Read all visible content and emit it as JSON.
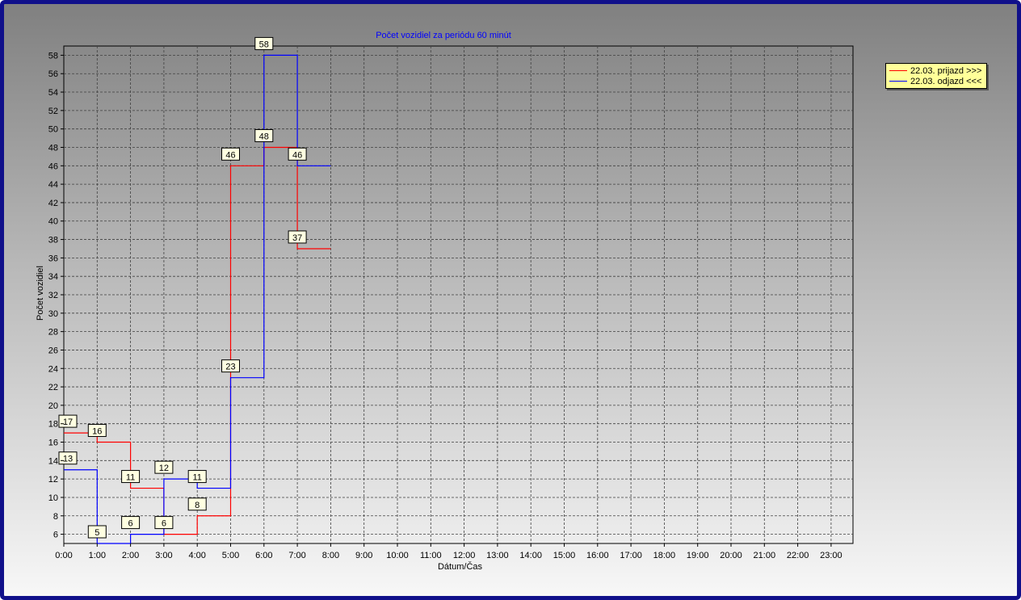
{
  "chart_data": {
    "type": "line",
    "title": "Počet vozidiel za periódu 60 minút",
    "xlabel": "Dátum/Čas",
    "ylabel": "Počet vozidiel",
    "categories": [
      "0:00",
      "1:00",
      "2:00",
      "3:00",
      "4:00",
      "5:00",
      "6:00",
      "7:00",
      "8:00",
      "9:00",
      "10:00",
      "11:00",
      "12:00",
      "13:00",
      "14:00",
      "15:00",
      "16:00",
      "17:00",
      "18:00",
      "19:00",
      "20:00",
      "21:00",
      "22:00",
      "23:00"
    ],
    "ylim": [
      5,
      59
    ],
    "yticks": [
      6,
      8,
      10,
      12,
      14,
      16,
      18,
      20,
      22,
      24,
      26,
      28,
      30,
      32,
      34,
      36,
      38,
      40,
      42,
      44,
      46,
      48,
      50,
      52,
      54,
      56,
      58
    ],
    "grid": true,
    "legend_position": "top-right",
    "series": [
      {
        "name": "22.03.  prijazd >>>",
        "color": "#ff0000",
        "values": [
          17,
          16,
          11,
          6,
          8,
          46,
          48,
          37
        ]
      },
      {
        "name": "22.03.  odjazd <<<",
        "color": "#0000ff",
        "values": [
          13,
          5,
          6,
          12,
          11,
          23,
          58,
          46
        ]
      }
    ]
  }
}
